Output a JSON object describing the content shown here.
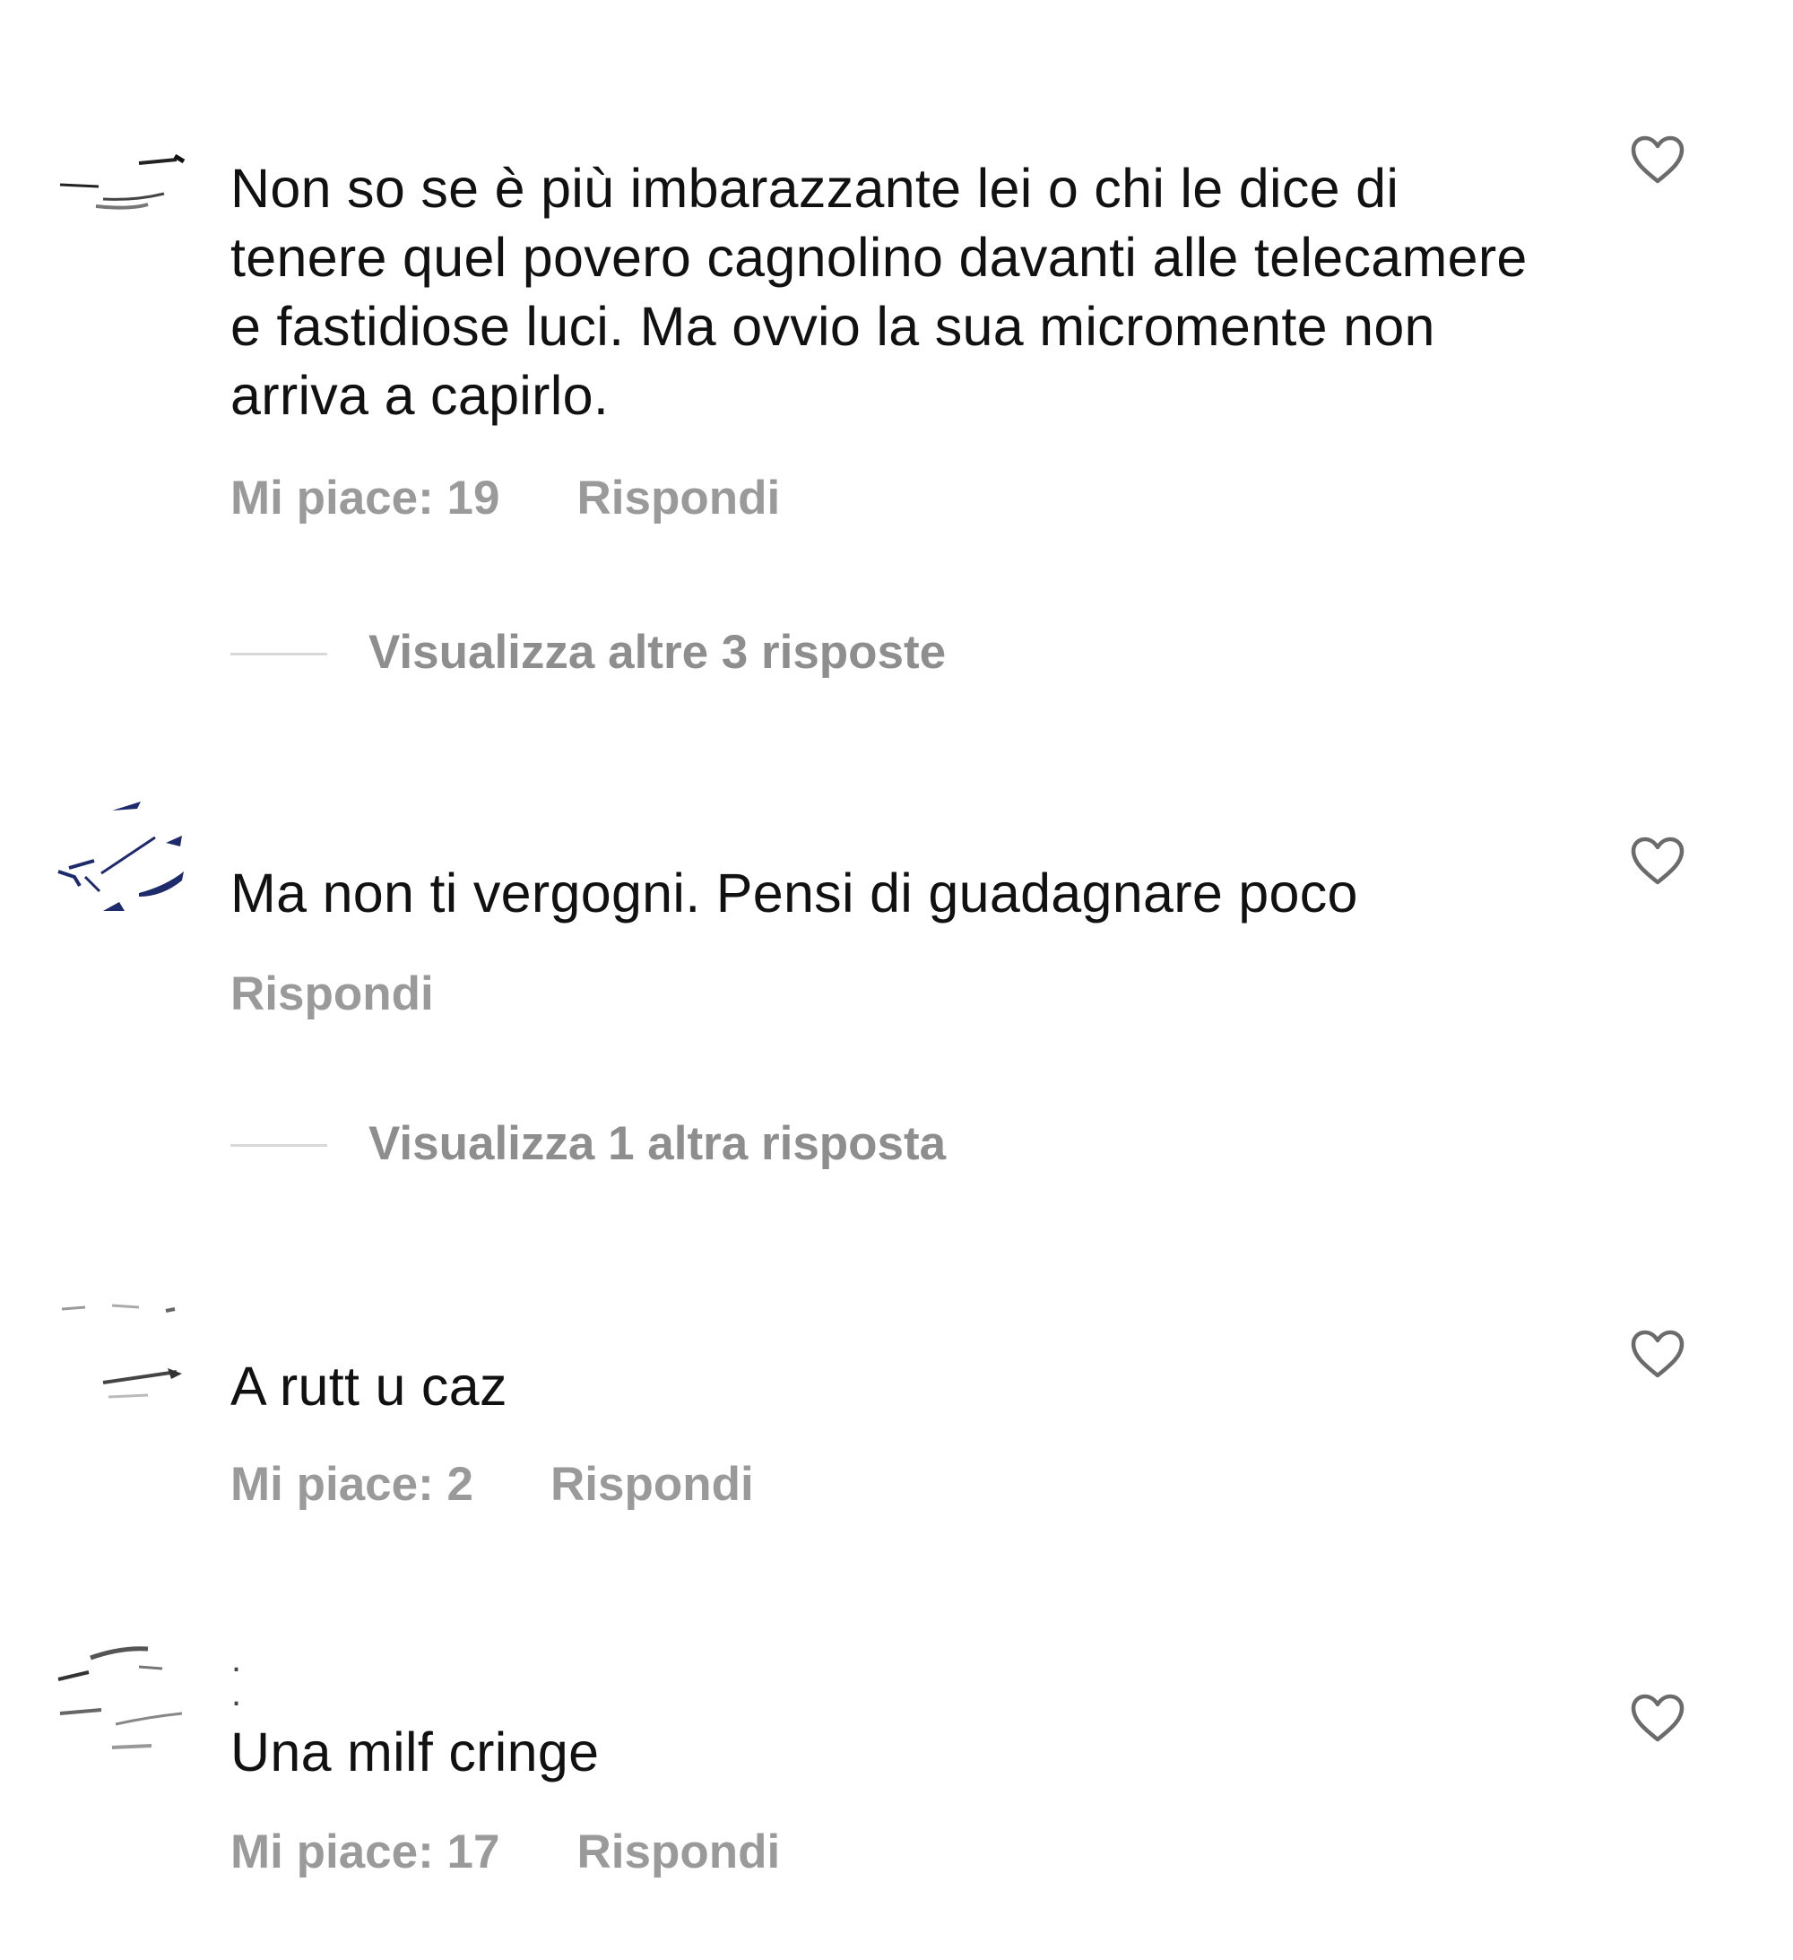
{
  "colors": {
    "text": "#111111",
    "meta": "#9a9a9a",
    "replies_link": "#8e8e8e",
    "divider": "#d8d8d8",
    "avatar_accent": "#1d2a6b"
  },
  "comments": [
    {
      "text": "Non so se è più imbarazzante lei o chi le dice di tenere quel povero cagnolino davanti alle telecamere e fastidiose luci. Ma ovvio la sua micromente non arriva a capirlo.",
      "likes": "Mi piace: 19",
      "reply": "Rispondi",
      "view_replies": "Visualizza altre 3 risposte",
      "like_icon": "heart-outline-icon"
    },
    {
      "text": "Ma non ti vergogni. Pensi di guadagnare poco",
      "likes": "",
      "reply": "Rispondi",
      "view_replies": "Visualizza 1 altra risposta",
      "like_icon": "heart-outline-icon"
    },
    {
      "text": "A rutt u caz",
      "likes": "Mi piace: 2",
      "reply": "Rispondi",
      "like_icon": "heart-outline-icon"
    },
    {
      "text": "Una milf cringe",
      "likes": "Mi piace: 17",
      "reply": "Rispondi",
      "like_icon": "heart-outline-icon"
    }
  ]
}
